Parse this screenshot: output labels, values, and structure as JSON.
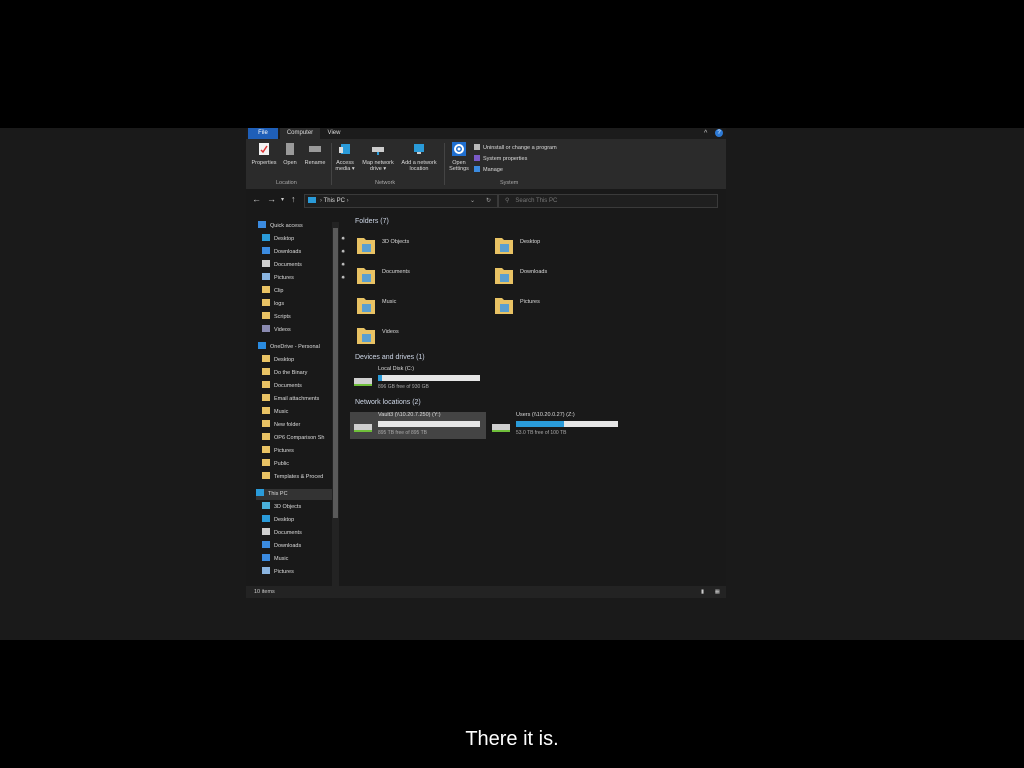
{
  "ribbon_tabs": {
    "file": "File",
    "computer": "Computer",
    "view": "View"
  },
  "ribbon": {
    "properties": "Properties",
    "open": "Open",
    "rename": "Rename",
    "access_media": "Access media ▾",
    "map_drive": "Map network drive ▾",
    "add_location": "Add a network location",
    "open_settings": "Open Settings",
    "uninstall": "Uninstall or change a program",
    "system_properties": "System properties",
    "manage": "Manage",
    "group_location": "Location",
    "group_network": "Network",
    "group_system": "System"
  },
  "address": {
    "path": "This PC",
    "search_placeholder": "Search This PC"
  },
  "sidebar": {
    "quick_access": "Quick access",
    "quick_items": [
      "Desktop",
      "Downloads",
      "Documents",
      "Pictures",
      "Clip",
      "logs",
      "Scripts",
      "Videos"
    ],
    "onedrive": "OneDrive - Personal",
    "onedrive_items": [
      "Desktop",
      "Do the Binary",
      "Documents",
      "Email attachments",
      "Music",
      "New folder",
      "OP6 Comparison Sh",
      "Pictures",
      "Public",
      "Templates & Proced"
    ],
    "this_pc": "This PC",
    "pc_items": [
      "3D Objects",
      "Desktop",
      "Documents",
      "Downloads",
      "Music",
      "Pictures"
    ]
  },
  "sections": {
    "folders": "Folders (7)",
    "devices": "Devices and drives (1)",
    "network": "Network locations (2)"
  },
  "folders": [
    "3D Objects",
    "Desktop",
    "Documents",
    "Downloads",
    "Music",
    "Pictures",
    "Videos"
  ],
  "drives": [
    {
      "name": "Local Disk (C:)",
      "free": "896 GB free of 930 GB",
      "used_fraction": 0.04
    },
    {
      "name": "Vault3 (\\\\10.20.7.250) (Y:)",
      "free": "895 TB free of 895 TB",
      "used_fraction": 0.0
    },
    {
      "name": "Users (\\\\10.20.0.27) (Z:)",
      "free": "53.0 TB free of 100 TB",
      "used_fraction": 0.47
    }
  ],
  "status": {
    "items": "10 items"
  },
  "caption": "There it is.",
  "colors": {
    "accent": "#1f5fb8",
    "drive_bar": "#2a9bd9",
    "folder": "#e8c264"
  }
}
